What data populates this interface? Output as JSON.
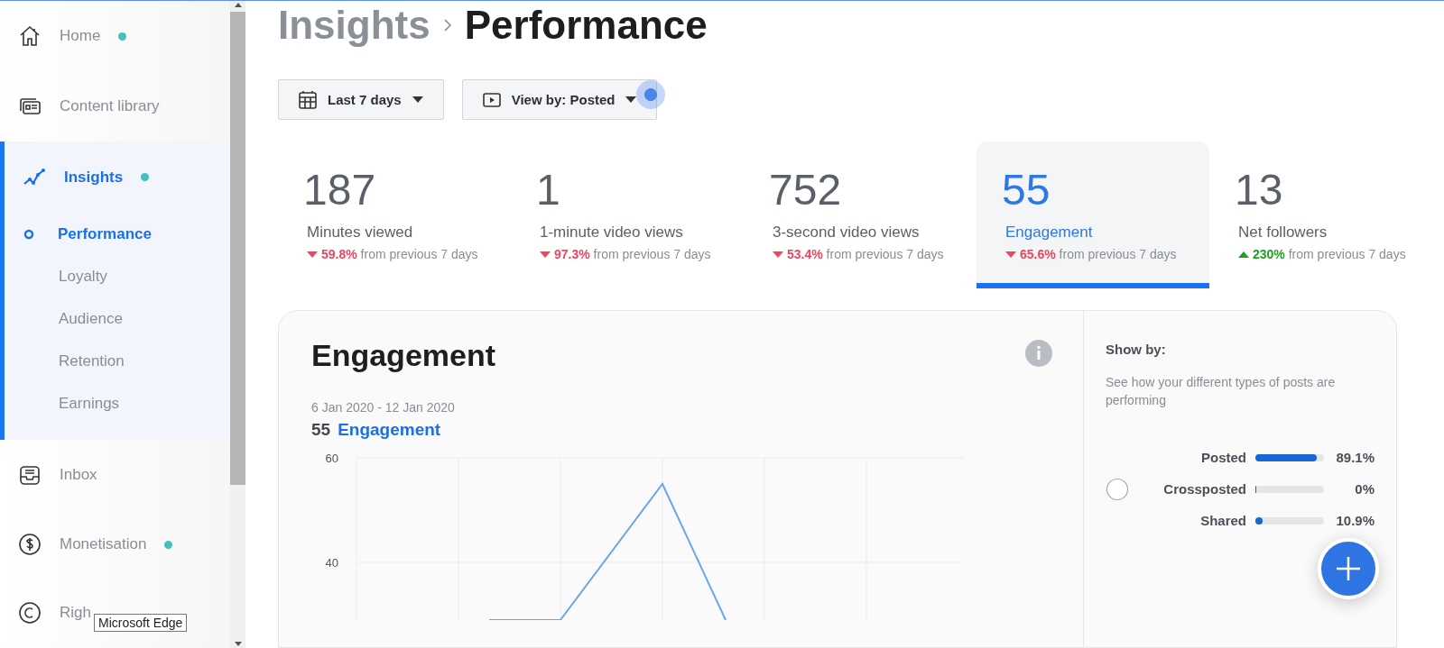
{
  "sidebar": {
    "items": [
      {
        "label": "Home",
        "dot": true,
        "selected": false
      },
      {
        "label": "Content library",
        "dot": false,
        "selected": false
      },
      {
        "label": "Insights",
        "dot": true,
        "selected": true,
        "children": [
          {
            "label": "Performance",
            "selected": true
          },
          {
            "label": "Loyalty",
            "selected": false
          },
          {
            "label": "Audience",
            "selected": false
          },
          {
            "label": "Retention",
            "selected": false
          },
          {
            "label": "Earnings",
            "selected": false
          }
        ]
      },
      {
        "label": "Inbox",
        "dot": false,
        "selected": false
      },
      {
        "label": "Monetisation",
        "dot": true,
        "selected": false
      },
      {
        "label": "Righ",
        "dot": false,
        "selected": false
      }
    ]
  },
  "tooltip": "Microsoft Edge",
  "breadcrumb": [
    "Insights",
    "Performance"
  ],
  "filters": [
    {
      "label": "Last 7 days"
    },
    {
      "label": "View by: Posted"
    }
  ],
  "metrics": [
    {
      "value": "187",
      "label": "Minutes viewed",
      "change": "59.8%",
      "kind": "decrease",
      "suffix": "from previous 7 days",
      "selected": false
    },
    {
      "value": "1",
      "label": "1-minute video views",
      "change": "97.3%",
      "kind": "decrease",
      "suffix": "from previous 7 days",
      "selected": false
    },
    {
      "value": "752",
      "label": "3-second video views",
      "change": "53.4%",
      "kind": "decrease",
      "suffix": "from previous 7 days",
      "selected": false
    },
    {
      "value": "55",
      "label": "Engagement",
      "change": "65.6%",
      "kind": "decrease",
      "suffix": "from previous 7 days",
      "selected": true
    },
    {
      "value": "13",
      "label": "Net followers",
      "change": "230%",
      "kind": "increase",
      "suffix": "from previous 7 days",
      "selected": false
    }
  ],
  "panel": {
    "title": "Engagement",
    "date_range": "6 Jan 2020 - 12 Jan 2020",
    "total": "55",
    "total_label": "Engagement",
    "y_axis_labels": [
      "60",
      "40"
    ]
  },
  "show_by": {
    "title": "Show by:",
    "description": "See how your different types of posts are performing",
    "radio_selected": false,
    "rows": [
      {
        "label": "Posted",
        "level": 0.891,
        "reading": "89.1%"
      },
      {
        "label": "Crossposted",
        "level": 0,
        "reading": "0%"
      },
      {
        "label": "Shared",
        "level": 0.109,
        "reading": "10.9%"
      }
    ]
  }
}
